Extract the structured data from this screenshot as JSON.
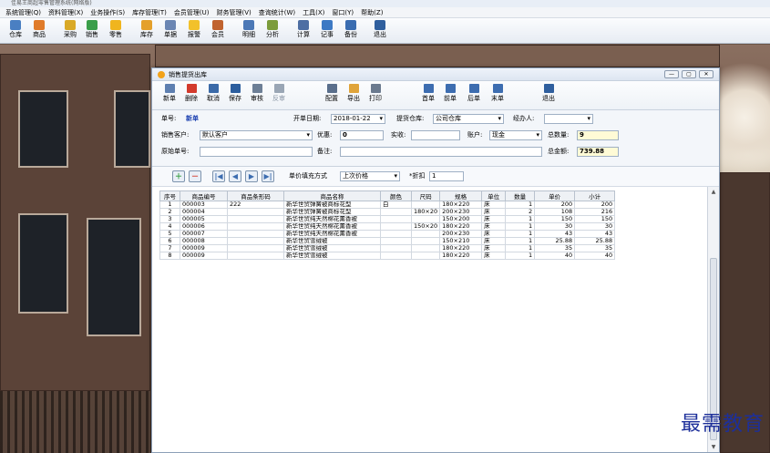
{
  "app": {
    "title": "佳易王商超零售管理系统(网络版)"
  },
  "menu": [
    "系统管理(Q)",
    "资料管理(X)",
    "业务操作(S)",
    "库存管理(T)",
    "会员管理(U)",
    "财务管理(V)",
    "查询统计(W)",
    "工具(X)",
    "窗口(Y)",
    "帮助(Z)"
  ],
  "toolbar": [
    {
      "label": "仓库",
      "icon": "warehouse-icon",
      "color": "#4a7fc2"
    },
    {
      "label": "商品",
      "icon": "product-icon",
      "color": "#e07b2a"
    },
    {
      "label": "采购",
      "icon": "purchase-icon",
      "color": "#d9a927"
    },
    {
      "label": "销售",
      "icon": "sales-icon",
      "color": "#3a9e4a"
    },
    {
      "label": "零售",
      "icon": "retail-icon",
      "color": "#f0b51e"
    },
    {
      "label": "库存",
      "icon": "stock-icon",
      "color": "#e4a02b"
    },
    {
      "label": "单据",
      "icon": "document-icon",
      "color": "#6b86b3"
    },
    {
      "label": "报警",
      "icon": "alarm-icon",
      "color": "#f2c12b"
    },
    {
      "label": "会员",
      "icon": "member-icon",
      "color": "#c0632f"
    },
    {
      "label": "明细",
      "icon": "detail-icon",
      "color": "#4c78b6"
    },
    {
      "label": "分析",
      "icon": "analysis-icon",
      "color": "#7c9c3c"
    },
    {
      "label": "计算",
      "icon": "calculator-icon",
      "color": "#4e6ea3"
    },
    {
      "label": "记事",
      "icon": "notes-icon",
      "color": "#3d79c4"
    },
    {
      "label": "备份",
      "icon": "backup-icon",
      "color": "#3a6cb0"
    },
    {
      "label": "退出",
      "icon": "exit-icon",
      "color": "#2f5f9e"
    }
  ],
  "window": {
    "title": "销售提货出库",
    "buttons": [
      {
        "label": "新单",
        "icon": "new-icon",
        "color": "#5e7fb0"
      },
      {
        "label": "删除",
        "icon": "delete-icon",
        "color": "#d33a2c"
      },
      {
        "label": "取消",
        "icon": "undo-icon",
        "color": "#3b6aa8"
      },
      {
        "label": "保存",
        "icon": "save-icon",
        "color": "#2c5e9e"
      },
      {
        "label": "审核",
        "icon": "audit-icon",
        "color": "#6d7f96"
      },
      {
        "label": "反审",
        "icon": "unaudit-icon",
        "color": "#9aa6b5"
      },
      {
        "label": "配置",
        "icon": "config-icon",
        "color": "#5a6f8c"
      },
      {
        "label": "导出",
        "icon": "export-icon",
        "color": "#e0a43a"
      },
      {
        "label": "打印",
        "icon": "print-icon",
        "color": "#6b7a8e"
      },
      {
        "label": "首单",
        "icon": "first-icon",
        "color": "#3d6db0"
      },
      {
        "label": "前单",
        "icon": "prev-icon",
        "color": "#3d6db0"
      },
      {
        "label": "后单",
        "icon": "next-icon",
        "color": "#3d6db0"
      },
      {
        "label": "末单",
        "icon": "last-icon",
        "color": "#3d6db0"
      },
      {
        "label": "退出",
        "icon": "exit-icon",
        "color": "#2f5f9e"
      }
    ]
  },
  "form": {
    "order_no_label": "单号:",
    "order_no": "新单",
    "date_label": "开单日期:",
    "date": "2018-01-22",
    "warehouse_label": "提货仓库:",
    "warehouse": "公司仓库",
    "handler_label": "经办人:",
    "handler": "",
    "customer_label": "销售客户:",
    "customer": "默认客户",
    "discount_label": "优惠:",
    "discount": "0",
    "received_label": "实收:",
    "received": "",
    "account_label": "账户:",
    "account": "现金",
    "total_qty_label": "总数量:",
    "total_qty": "9",
    "orig_no_label": "原始单号:",
    "orig_no": "",
    "remark_label": "备注:",
    "remark": "",
    "total_amount_label": "总金额:",
    "total_amount": "739.88"
  },
  "bar2": {
    "price_mode_label": "单价填充方式",
    "price_mode": "上次价格",
    "discount_rate_label": "*折扣",
    "discount_rate": "1"
  },
  "grid": {
    "headers": [
      "序号",
      "商品编号",
      "商品条形码",
      "商品名称",
      "颜色",
      "尺码",
      "规格",
      "单位",
      "数量",
      "单价",
      "小计"
    ],
    "rows": [
      [
        "1",
        "000003",
        "222",
        "新华世贸弹簧被商标花型",
        "白",
        "",
        "180×220",
        "床",
        "1",
        "200",
        "200"
      ],
      [
        "2",
        "000004",
        "",
        "新华世贸弹簧被商标花型",
        "",
        "180×20",
        "200×230",
        "床",
        "2",
        "108",
        "216"
      ],
      [
        "3",
        "000005",
        "",
        "新华世贸纯天然棉花薰香被",
        "",
        "",
        "150×200",
        "床",
        "1",
        "150",
        "150"
      ],
      [
        "4",
        "000006",
        "",
        "新华世贸纯天然棉花薰香被",
        "",
        "150×20",
        "180×220",
        "床",
        "1",
        "30",
        "30"
      ],
      [
        "5",
        "000007",
        "",
        "新华世贸纯天然棉花薰香被",
        "",
        "",
        "200×230",
        "床",
        "1",
        "43",
        "43"
      ],
      [
        "6",
        "000008",
        "",
        "新华世贸雪绒被",
        "",
        "",
        "150×210",
        "床",
        "1",
        "25.88",
        "25.88"
      ],
      [
        "7",
        "000009",
        "",
        "新华世贸雪绒被",
        "",
        "",
        "180×220",
        "床",
        "1",
        "35",
        "35"
      ],
      [
        "8",
        "000009",
        "",
        "新华世贸雪绒被",
        "",
        "",
        "180×220",
        "床",
        "1",
        "40",
        "40"
      ]
    ]
  },
  "watermark": "最需教育"
}
